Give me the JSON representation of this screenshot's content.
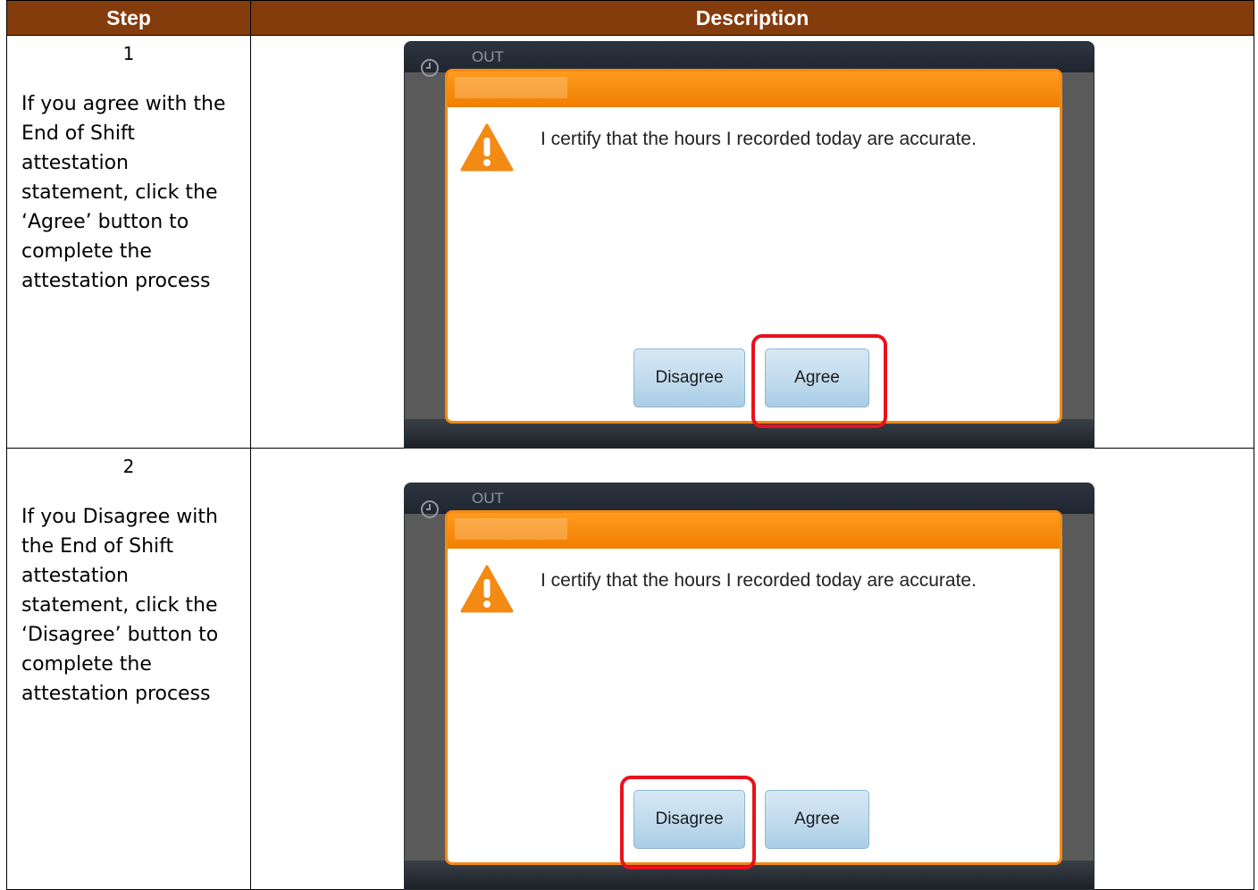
{
  "table": {
    "headers": [
      "Step",
      "Description"
    ]
  },
  "rows": [
    {
      "step": "1",
      "text": "If you agree with the End of Shift attestation statement, click the ‘Agree’ button to complete the attestation process",
      "highlighted_button": "Agree"
    },
    {
      "step": "2",
      "text": "If you Disagree with the End of Shift attestation statement, click the ‘Disagree’ button to complete the attestation process",
      "highlighted_button": "Disagree"
    }
  ],
  "screen": {
    "top_label": "OUT",
    "dialog_message": "I certify that the hours I recorded today are accurate.",
    "disagree_label": "Disagree",
    "agree_label": "Agree"
  },
  "colors": {
    "header_bg": "#843c0c",
    "dialog_accent": "#f28a14",
    "highlight": "#e8121c",
    "button_fill": "#c3dcee"
  },
  "icons": {
    "clock": "clock-icon",
    "warning": "warning-icon"
  }
}
